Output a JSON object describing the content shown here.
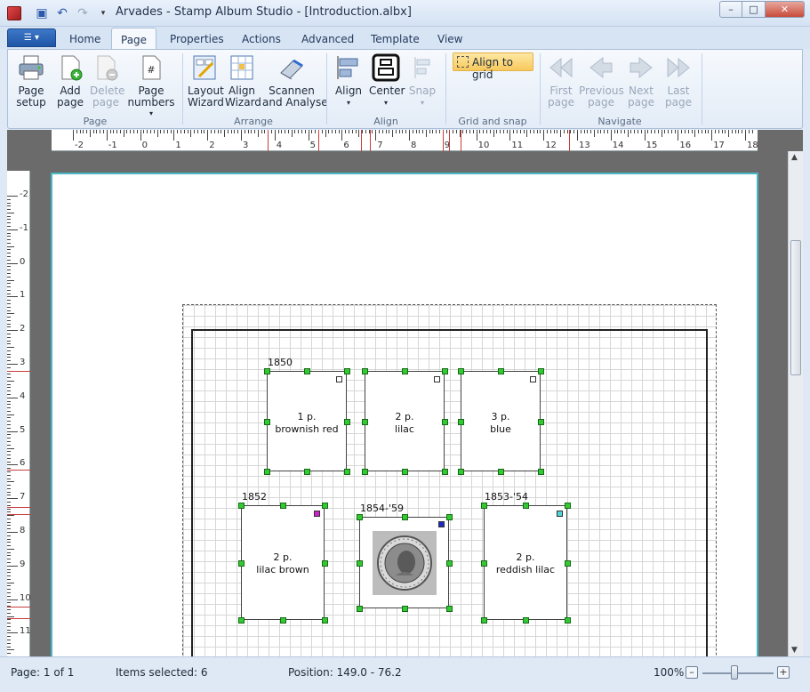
{
  "window": {
    "title": "Arvades - Stamp Album Studio - [Introduction.albx]",
    "minimize_glyph": "–",
    "maximize_glyph": "□",
    "close_glyph": "✕"
  },
  "quick_access": {
    "save_icon": "save-icon",
    "undo_icon": "undo-icon",
    "redo_icon": "redo-icon",
    "customize_icon": "dropdown-arrow-icon"
  },
  "ribbon": {
    "file_menu_icon": "app-menu-icon",
    "tabs": [
      {
        "label": "Home"
      },
      {
        "label": "Page"
      },
      {
        "label": "Properties"
      },
      {
        "label": "Actions"
      },
      {
        "label": "Advanced"
      },
      {
        "label": "Template"
      },
      {
        "label": "View"
      }
    ],
    "active_tab": "Page",
    "groups": {
      "page": {
        "label": "Page",
        "setup": "Page\nsetup",
        "add": "Add\npage",
        "delete": "Delete\npage",
        "numbers": "Page\nnumbers"
      },
      "arrange": {
        "label": "Arrange",
        "layout_wizard": "Layout\nWizard",
        "align_wizard": "Align\nWizard",
        "scan": "Scannen\nand Analyse"
      },
      "align": {
        "label": "Align",
        "align": "Align",
        "center": "Center",
        "snap": "Snap"
      },
      "grid": {
        "label": "Grid and snap",
        "align_to_grid": "Align to grid"
      },
      "navigate": {
        "label": "Navigate",
        "first": "First\npage",
        "previous": "Previous\npage",
        "next": "Next\npage",
        "last": "Last\npage"
      }
    }
  },
  "rulers": {
    "horizontal": [
      "-2",
      "-1",
      "0",
      "1",
      "2",
      "3",
      "4",
      "5",
      "6",
      "7",
      "8",
      "9",
      "10",
      "11",
      "12",
      "13",
      "14",
      "15",
      "16",
      "17",
      "18"
    ],
    "vertical": [
      "-2",
      "-1",
      "0",
      "1",
      "2",
      "3",
      "4",
      "5",
      "6",
      "7",
      "8",
      "9",
      "10",
      "11"
    ]
  },
  "album": {
    "rows": [
      {
        "year": "1850",
        "stamps": [
          {
            "line1": "1 p.",
            "line2": "brownish red",
            "marker_color": "#ffffff"
          },
          {
            "line1": "2 p.",
            "line2": "lilac",
            "marker_color": "#ffffff"
          },
          {
            "line1": "3 p.",
            "line2": "blue",
            "marker_color": "#ffffff"
          }
        ]
      },
      {
        "stamps": [
          {
            "year": "1852",
            "line1": "2 p.",
            "line2": "lilac brown",
            "marker_color": "#cc22cc"
          },
          {
            "year": "1854-'59",
            "image": "stamp-image",
            "marker_color": "#1a2bbf"
          },
          {
            "year": "1853-'54",
            "line1": "2 p.",
            "line2": "reddish lilac",
            "marker_color": "#4fd6d6"
          }
        ]
      }
    ]
  },
  "statusbar": {
    "page": "Page: 1 of 1",
    "selected": "Items selected: 6",
    "position": "Position: 149.0 - 76.2",
    "zoom": "100%",
    "zoom_minus": "–",
    "zoom_plus": "+"
  },
  "colors": {
    "selection_handle": "#35c835",
    "ribbon_highlight": "#f8c95c",
    "page_border": "#48b8c4"
  }
}
